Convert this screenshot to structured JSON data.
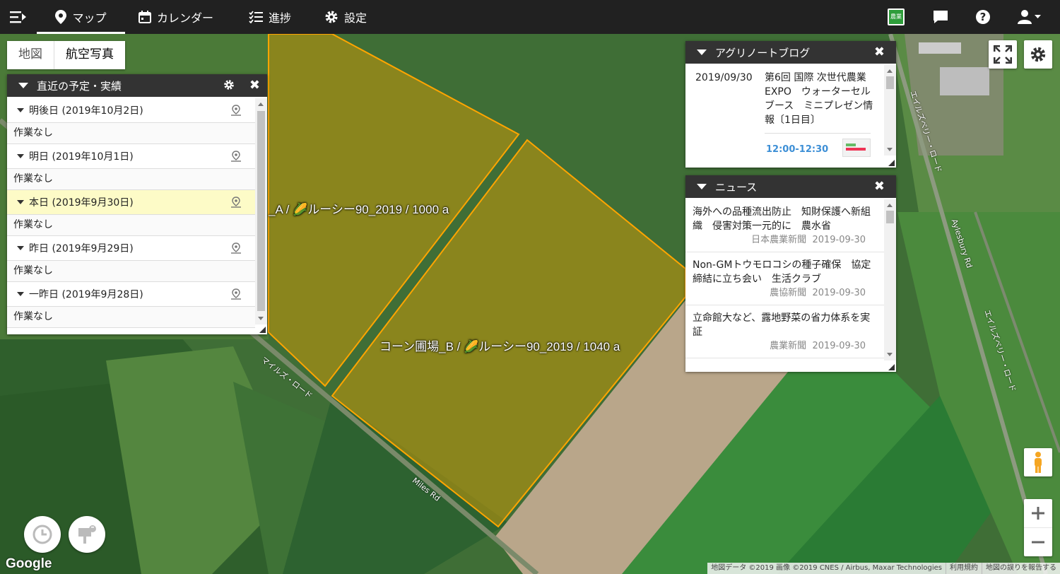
{
  "nav": {
    "items": [
      {
        "label": "マップ",
        "icon": "map-pin-icon",
        "active": true
      },
      {
        "label": "カレンダー",
        "icon": "calendar-icon"
      },
      {
        "label": "進捗",
        "icon": "checklist-icon"
      },
      {
        "label": "設定",
        "icon": "gear-icon"
      }
    ],
    "app_icon_text": "農業"
  },
  "map_type": {
    "map_label": "地図",
    "satellite_label": "航空写真",
    "selected": "satellite"
  },
  "fields": [
    {
      "label": "_A / 🌽ルーシー90_2019 / 1000 a"
    },
    {
      "label": "コーン圃場_B / 🌽ルーシー90_2019 / 1040 a"
    }
  ],
  "roads": {
    "road1": "マイルズ・ロード",
    "road2": "Miles Rd",
    "road3": "エイルズベリー・ロード",
    "road4": "Aylesbury Rd",
    "road5": "エイルズベリー・ロード"
  },
  "schedule_panel": {
    "title": "直近の予定・実績",
    "rows": [
      {
        "day": "明後日 (2019年10月2日)",
        "note": "作業なし",
        "today": false
      },
      {
        "day": "明日 (2019年10月1日)",
        "note": "作業なし",
        "today": false
      },
      {
        "day": "本日 (2019年9月30日)",
        "note": "作業なし",
        "today": true
      },
      {
        "day": "昨日 (2019年9月29日)",
        "note": "作業なし",
        "today": false
      },
      {
        "day": "一昨日 (2019年9月28日)",
        "note": "作業なし",
        "today": false
      }
    ]
  },
  "blog_panel": {
    "title": "アグリノートブログ",
    "entry": {
      "date": "2019/09/30",
      "title": "第6回 国際 次世代農業EXPO　ウォーターセルブース　ミニプレゼン情報〔1日目〕",
      "time": "12:00-12:30"
    }
  },
  "news_panel": {
    "title": "ニュース",
    "items": [
      {
        "headline": "海外への品種流出防止　知財保護へ新組織　侵害対策一元的に　農水省",
        "source": "日本農業新聞",
        "date": "2019-09-30"
      },
      {
        "headline": "Non-GMトウモロコシの種子確保　協定締結に立ち会い　生活クラブ",
        "source": "農協新聞",
        "date": "2019-09-30"
      },
      {
        "headline": "立命館大など、露地野菜の省力体系を実証",
        "source": "農業新聞",
        "date": "2019-09-30"
      }
    ]
  },
  "attribution": {
    "data": "地図データ ©2019 画像 ©2019 CNES / Airbus, Maxar Technologies",
    "terms": "利用規約",
    "report": "地図の誤りを報告する",
    "logo": "Google"
  },
  "colors": {
    "topbar": "#212121",
    "field_fill": "#b8930f",
    "field_stroke": "#ffa500",
    "today_row": "#fdfbc7",
    "link_time": "#3d8fd6"
  }
}
